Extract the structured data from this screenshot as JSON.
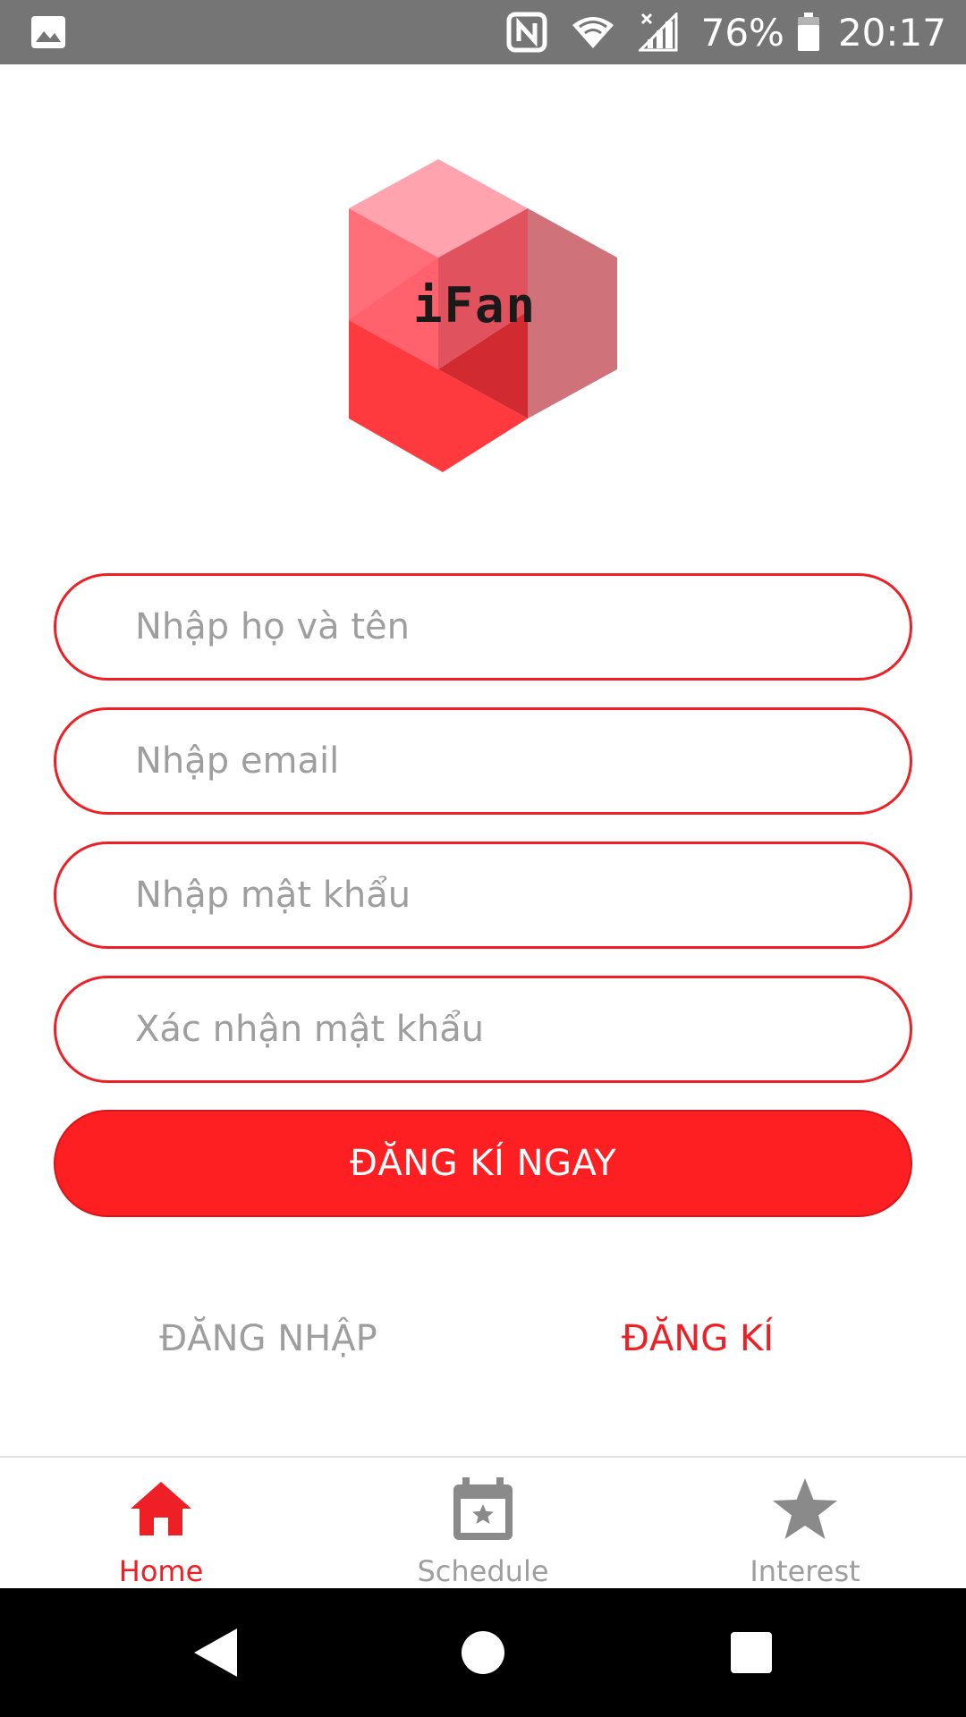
{
  "status_bar": {
    "battery_percent": "76%",
    "time": "20:17",
    "icons": [
      "gallery-notification-icon",
      "nfc-icon",
      "wifi-icon",
      "cellular-signal-icon",
      "battery-icon"
    ]
  },
  "logo": {
    "text": "iFan",
    "colors": {
      "top": "#ffa3ae",
      "right": "#d0727a",
      "left": "#ff3a3e",
      "center": "#ff626c",
      "inner": "#d12a31"
    }
  },
  "form": {
    "full_name_placeholder": "Nhập họ và tên",
    "email_placeholder": "Nhập email",
    "password_placeholder": "Nhập mật khẩu",
    "confirm_password_placeholder": "Xác nhận mật khẩu",
    "submit_label": "ĐĂNG KÍ NGAY"
  },
  "auth_tabs": {
    "login_label": "ĐĂNG NHẬP",
    "register_label": "ĐĂNG KÍ",
    "active": "register"
  },
  "bottom_nav": {
    "items": [
      {
        "label": "Home",
        "icon": "home-icon",
        "active": true
      },
      {
        "label": "Schedule",
        "icon": "calendar-star-icon",
        "active": false
      },
      {
        "label": "Interest",
        "icon": "star-icon",
        "active": false
      }
    ]
  },
  "colors": {
    "accent": "#ee2026",
    "button": "#fe1f23",
    "status_bar": "#757575",
    "inactive": "#9e9e9e"
  }
}
